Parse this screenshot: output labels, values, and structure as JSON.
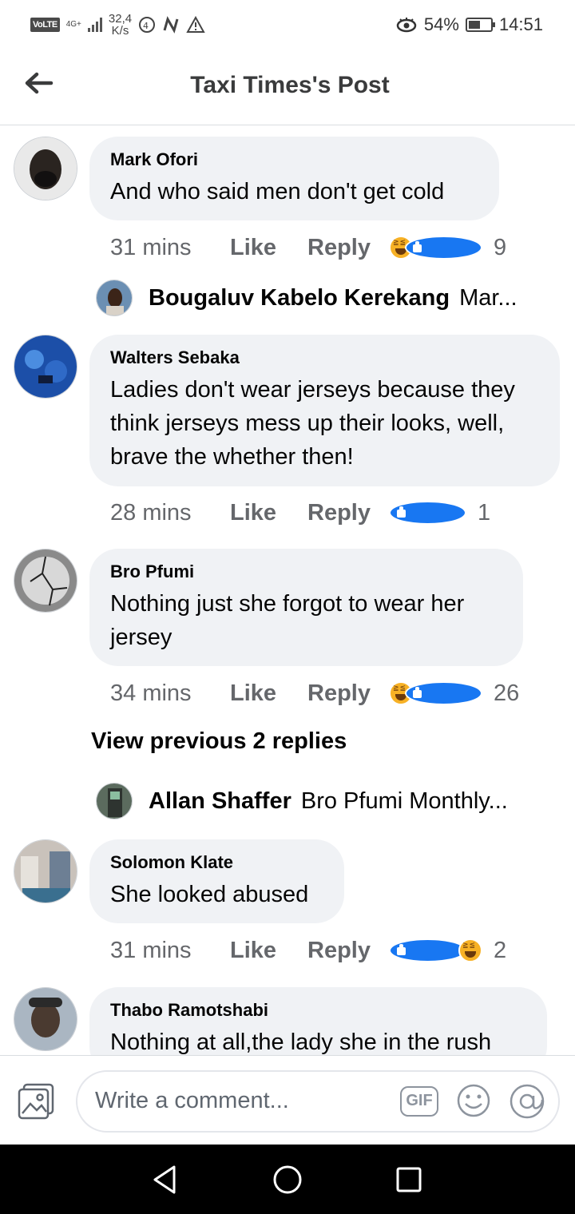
{
  "status_bar": {
    "volte": "VoLTE",
    "network": "4G+",
    "speed_value": "32,4",
    "speed_unit": "K/s",
    "battery_percent": "54%",
    "battery_level": 0.54,
    "time": "14:51"
  },
  "header": {
    "title": "Taxi Times's Post"
  },
  "comments": [
    {
      "author": "Mark Ofori",
      "text": "And who said men don't get cold",
      "time": "31 mins",
      "like": "Like",
      "reply": "Reply",
      "reactions": [
        "haha",
        "like"
      ],
      "reaction_count": "9",
      "reply_preview": {
        "name": "Bougaluv Kabelo Kerekang",
        "text": "Mar..."
      }
    },
    {
      "author": "Walters Sebaka",
      "text": "Ladies don't wear jerseys because they think jerseys mess up their looks, well, brave the whether then!",
      "time": "28 mins",
      "like": "Like",
      "reply": "Reply",
      "reactions": [
        "like"
      ],
      "reaction_count": "1"
    },
    {
      "author": "Bro Pfumi",
      "text": "Nothing just she forgot to wear her jersey",
      "time": "34 mins",
      "like": "Like",
      "reply": "Reply",
      "reactions": [
        "haha",
        "like"
      ],
      "reaction_count": "26",
      "view_previous": "View previous 2 replies",
      "reply_preview": {
        "name": "Allan Shaffer",
        "text": "Bro Pfumi Monthly..."
      }
    },
    {
      "author": "Solomon Klate",
      "text": "She looked abused",
      "time": "31 mins",
      "like": "Like",
      "reply": "Reply",
      "reactions": [
        "like",
        "haha"
      ],
      "reaction_count": "2"
    },
    {
      "author": "Thabo Ramotshabi",
      "text": "Nothing at all,the lady she in the rush"
    }
  ],
  "composer": {
    "placeholder": "Write a comment...",
    "gif_label": "GIF"
  },
  "colors": {
    "bubble": "#f0f2f5",
    "meta_text": "#65676b",
    "like_blue": "#1877f2",
    "haha_yellow": "#f7b125"
  }
}
